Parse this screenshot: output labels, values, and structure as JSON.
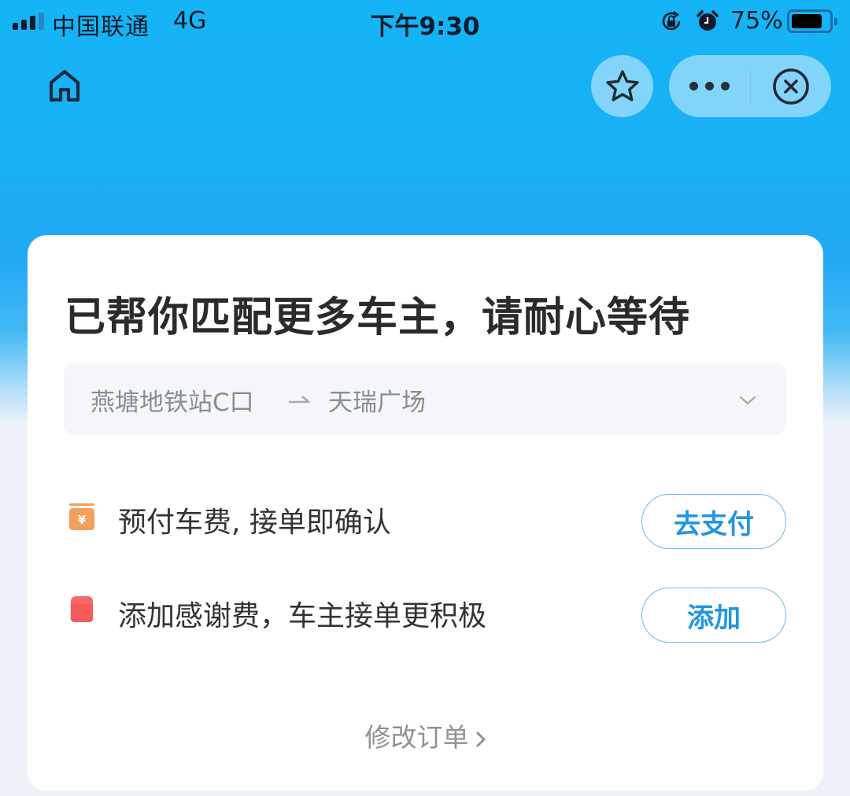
{
  "status_bar": {
    "carrier": "中国联通",
    "network": "4G",
    "time": "下午9:30",
    "battery_percent_text": "75%",
    "battery_level": 0.75,
    "signal_bars": 4,
    "signal_bars_strong": 3,
    "icons": [
      "signal-icon",
      "rotation-lock-icon",
      "alarm-icon",
      "battery-icon"
    ]
  },
  "nav": {
    "home_icon": "home-icon",
    "favorite_icon": "star-icon",
    "more_icon": "more-dots-icon",
    "close_icon": "close-circle-icon"
  },
  "card": {
    "title": "已帮你匹配更多车主，请耐心等待",
    "route": {
      "from": "燕塘地铁站C口",
      "to": "天瑞广场",
      "arrow_icon": "route-arrow-icon",
      "expand_icon": "chevron-down-icon"
    },
    "actions": [
      {
        "icon": "prepay-wallet-icon",
        "icon_color": "#f5a05a",
        "text": "预付车费, 接单即确认",
        "button_label": "去支付"
      },
      {
        "icon": "red-packet-icon",
        "icon_color": "#f55a5a",
        "text": "添加感谢费，车主接单更积极",
        "button_label": "添加"
      }
    ],
    "modify_link": "修改订单"
  },
  "colors": {
    "accent_blue": "#2196e0",
    "header_blue": "#14b4f6",
    "title_text": "#2b2b2b",
    "muted_text": "#8e9196"
  }
}
